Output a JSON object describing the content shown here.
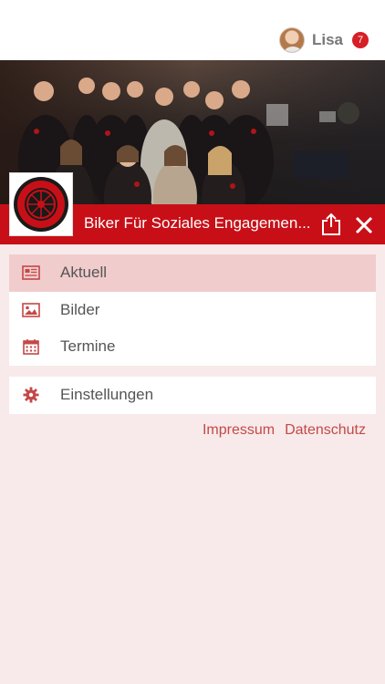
{
  "header": {
    "user_name": "Lisa",
    "notification_count": "7"
  },
  "hero": {
    "logo_text": "BIKER FÜR SOZIALES ENGAGEMENT E.V.",
    "title": "Biker Für Soziales Engagemen..."
  },
  "menu": {
    "items": [
      {
        "label": "Aktuell",
        "icon": "newspaper-icon",
        "active": true
      },
      {
        "label": "Bilder",
        "icon": "image-icon",
        "active": false
      },
      {
        "label": "Termine",
        "icon": "calendar-icon",
        "active": false
      }
    ],
    "settings_label": "Einstellungen",
    "settings_icon": "gear-icon"
  },
  "footer": {
    "impressum": "Impressum",
    "datenschutz": "Datenschutz"
  },
  "colors": {
    "brand_red": "#c80f17",
    "active_row": "#f1cccd",
    "background": "#f8eaea",
    "link": "#c44848"
  }
}
